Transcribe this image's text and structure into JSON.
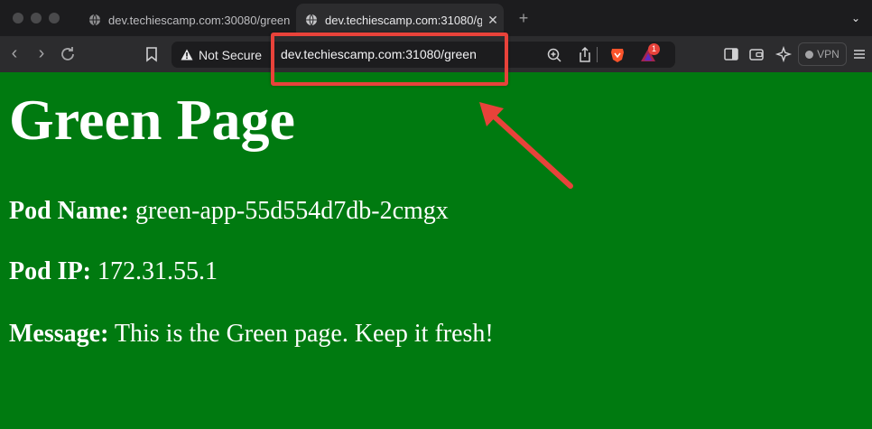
{
  "browser": {
    "tabs": [
      {
        "title": "dev.techiescamp.com:30080/green",
        "active": false
      },
      {
        "title": "dev.techiescamp.com:31080/green",
        "active": true
      }
    ],
    "new_tab": "+",
    "tab_menu": "⌄",
    "security_label": "Not Secure",
    "url": "dev.techiescamp.com:31080/green",
    "notification_count": "1",
    "vpn_label": "VPN"
  },
  "page": {
    "heading": "Green Page",
    "pod_name_label": "Pod Name:",
    "pod_name": "green-app-55d554d7db-2cmgx",
    "pod_ip_label": "Pod IP:",
    "pod_ip": "172.31.55.1",
    "message_label": "Message:",
    "message": "This is the Green page. Keep it fresh!"
  },
  "colors": {
    "page_background": "#007a10",
    "annotation": "#e8423a"
  },
  "icons": [
    "globe-icon",
    "close-icon",
    "back-icon",
    "forward-icon",
    "reload-icon",
    "bookmark-icon",
    "warning-icon",
    "zoom-icon",
    "share-icon",
    "brave-shield-icon",
    "brave-rewards-icon",
    "sidebar-icon",
    "wallet-icon",
    "leo-ai-icon",
    "vpn-icon"
  ]
}
